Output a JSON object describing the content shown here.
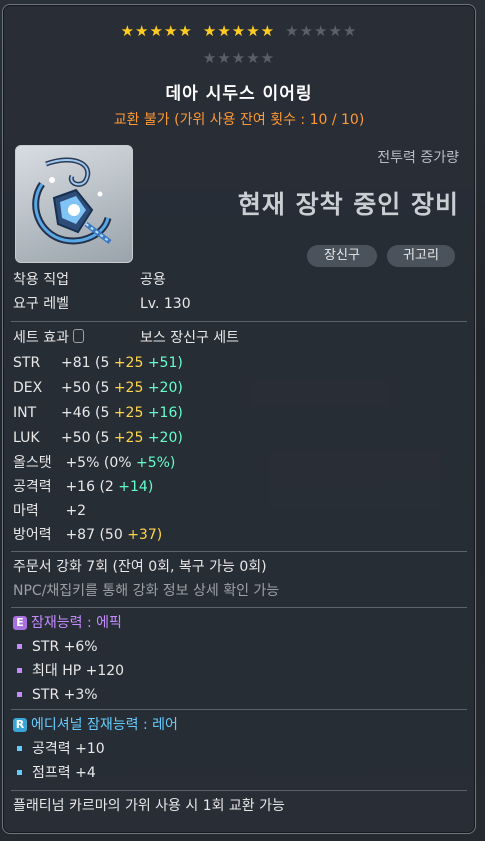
{
  "stars": {
    "row1_filled": 10,
    "row1_empty": 5,
    "row2_empty": 5,
    "filled_glyph": "★",
    "empty_glyph": "★",
    "filled_color": "#ffcc22",
    "empty_color": "#5a6068"
  },
  "item": {
    "name": "데아 시두스 이어링",
    "trade_info": "교환 불가 (가위 사용 잔여 횟수 : 10 / 10)",
    "icon": "earring-icon",
    "power_label": "전투력 증가량",
    "equipped_text": "현재 장착 중인 장비",
    "tags": [
      "장신구",
      "귀고리"
    ]
  },
  "requirements": {
    "job_label": "착용 직업",
    "job_value": "공용",
    "level_label": "요구 레벨",
    "level_value": "Lv. 130"
  },
  "set_effect": {
    "label": "세트 효과",
    "value": "보스 장신구 세트"
  },
  "stats": [
    {
      "key": "STR",
      "total": "+81",
      "base": "(5",
      "scroll": "+25",
      "flame": "+51)"
    },
    {
      "key": "DEX",
      "total": "+50",
      "base": "(5",
      "scroll": "+25",
      "flame": "+20)"
    },
    {
      "key": "INT",
      "total": "+46",
      "base": "(5",
      "scroll": "+25",
      "flame": "+16)"
    },
    {
      "key": "LUK",
      "total": "+50",
      "base": "(5",
      "scroll": "+25",
      "flame": "+20)"
    }
  ],
  "allstat": {
    "label": "올스탯",
    "total": "+5%",
    "base": "(0%",
    "flame": "+5%)"
  },
  "attack": {
    "label": "공격력",
    "total": "+16",
    "base": "(2",
    "flame": "+14)"
  },
  "magic": {
    "label": "마력",
    "total": "+2"
  },
  "defense": {
    "label": "방어력",
    "total": "+87",
    "base": "(50",
    "scroll": "+37)"
  },
  "upgrade": {
    "line1": "주문서 강화 7회 (잔여 0회, 복구 가능 0회)",
    "line2": "NPC/채집키를 통해 강화 정보 상세 확인 가능"
  },
  "potential": {
    "badge": "E",
    "title": "잠재능력 : 에픽",
    "color": "#c58bff",
    "lines": [
      "STR +6%",
      "최대 HP +120",
      "STR +3%"
    ]
  },
  "additional": {
    "badge": "R",
    "title": "에디셔널 잠재능력 : 레어",
    "color": "#66ccff",
    "lines": [
      "공격력 +10",
      "점프력 +4"
    ]
  },
  "footer": "플래티넘 카르마의 가위 사용 시 1회 교환 가능"
}
